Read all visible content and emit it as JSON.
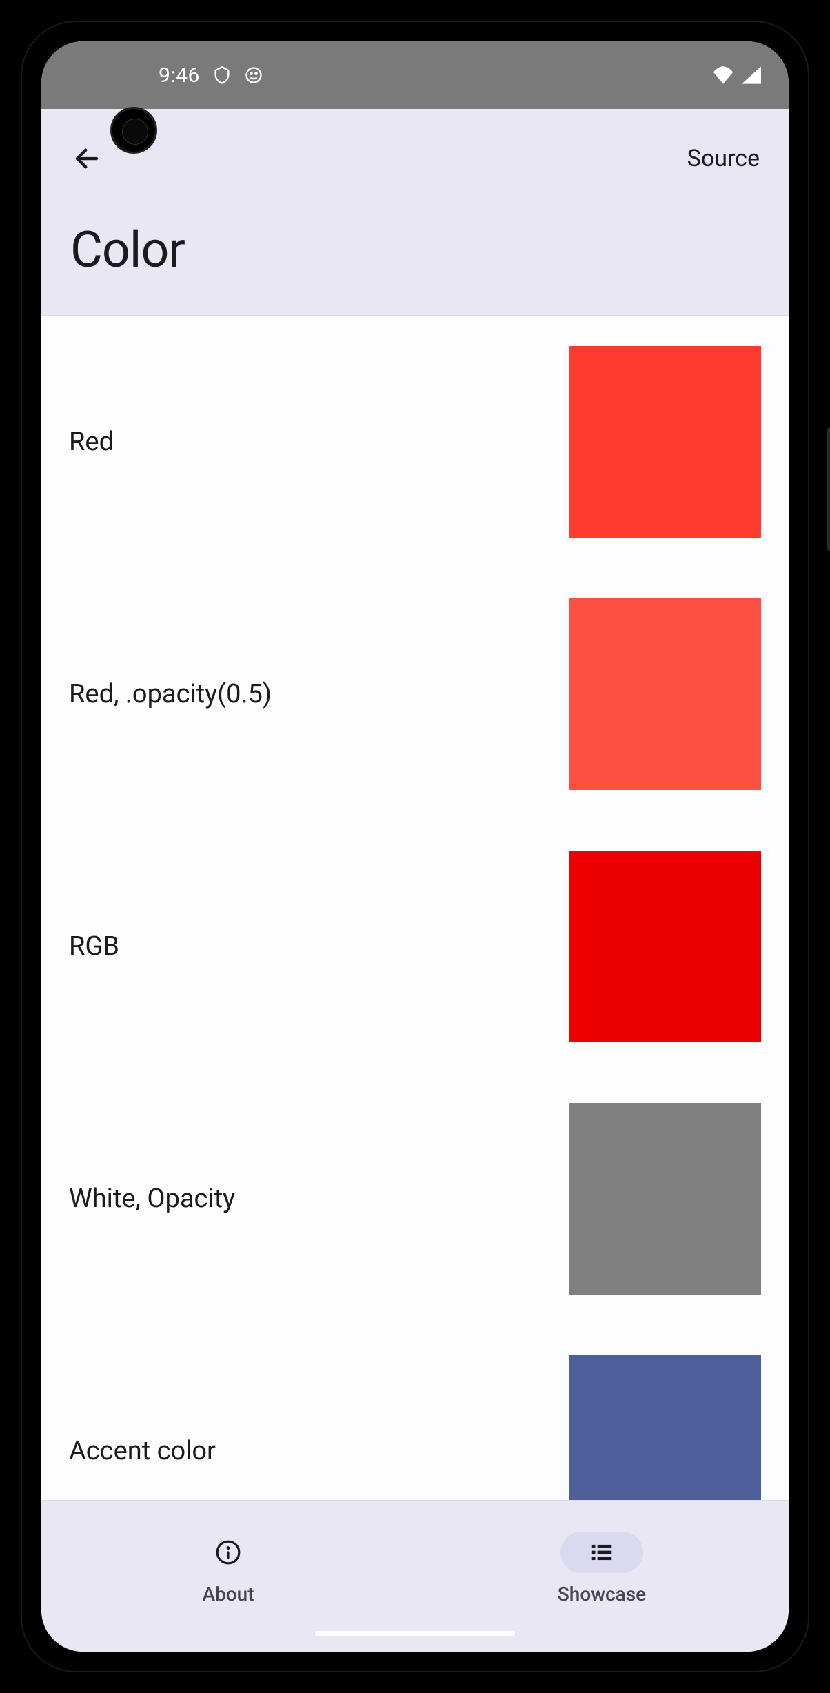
{
  "status": {
    "time": "9:46"
  },
  "header": {
    "title": "Color",
    "action": "Source"
  },
  "items": [
    {
      "label": "Red",
      "color": "#ff3a2f"
    },
    {
      "label": "Red, .opacity(0.5)",
      "color": "#fe4f43"
    },
    {
      "label": "RGB",
      "color": "#ee0000"
    },
    {
      "label": "White, Opacity",
      "color": "#808080"
    },
    {
      "label": "Accent color",
      "color": "#4d5f9a"
    }
  ],
  "nav": {
    "about": "About",
    "showcase": "Showcase"
  }
}
